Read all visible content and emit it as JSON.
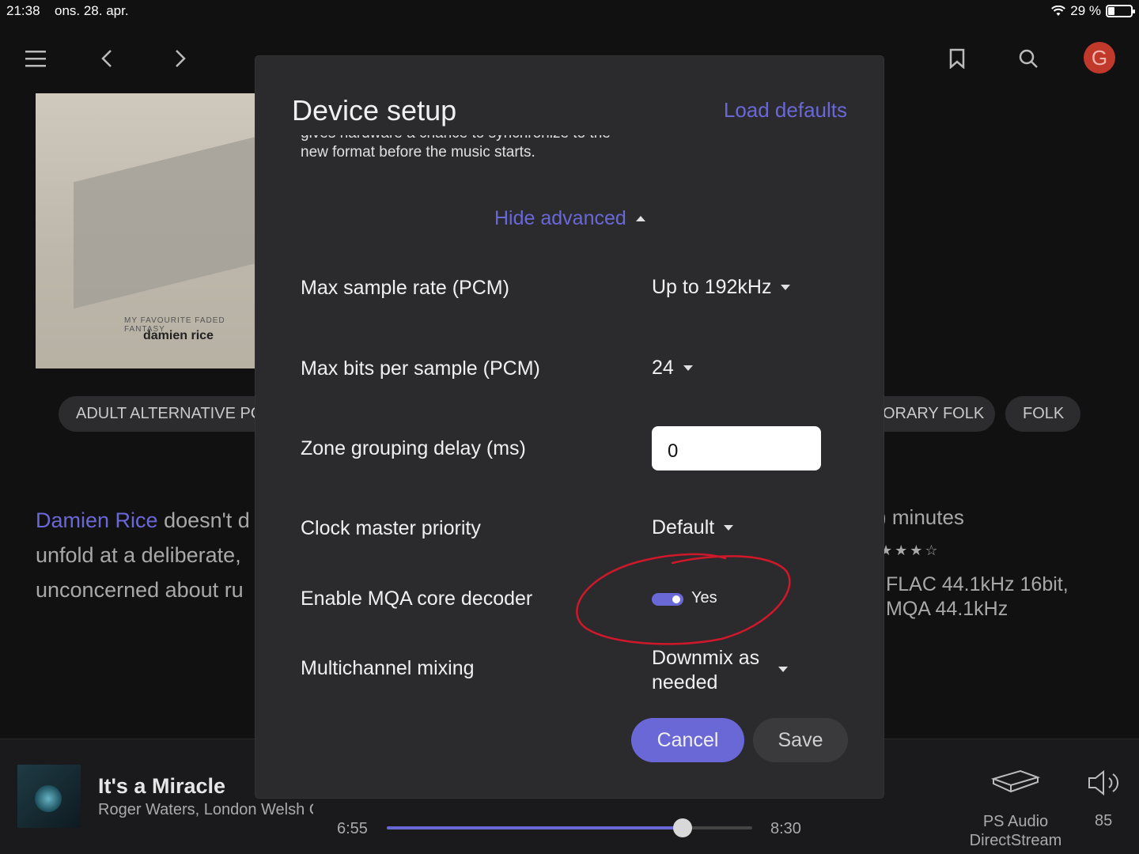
{
  "status_bar": {
    "time": "21:38",
    "date": "ons. 28. apr.",
    "battery": "29 %"
  },
  "top_nav": {
    "avatar_letter": "G"
  },
  "background": {
    "album": {
      "title": "MY FAVOURITE FADED FANTASY",
      "artist": "damien rice"
    },
    "genre_chips": [
      "ADULT ALTERNATIVE PC",
      "ORARY FOLK",
      "FOLK"
    ],
    "bio": {
      "artist_link": "Damien Rice",
      "line1_rest": " doesn't d",
      "line2": "unfold at a deliberate,",
      "line3": "unconcerned about ru"
    },
    "details": {
      "duration": ") minutes",
      "rating": "★★★☆",
      "format_line1": "FLAC 44.1kHz 16bit,",
      "format_line2": "MQA 44.1kHz"
    }
  },
  "dialog": {
    "title": "Device setup",
    "load_defaults": "Load defaults",
    "description_line1": "gives hardware a chance to synchronize to the",
    "description_line2": "new format before the music starts.",
    "hide_advanced": "Hide advanced",
    "settings": {
      "max_sample_rate": {
        "label": "Max sample rate (PCM)",
        "value": "Up to 192kHz"
      },
      "max_bits": {
        "label": "Max bits per sample (PCM)",
        "value": "24"
      },
      "zone_grouping_delay": {
        "label": "Zone grouping delay (ms)",
        "value": "0"
      },
      "clock_master": {
        "label": "Clock master priority",
        "value": "Default"
      },
      "mqa_decoder": {
        "label": "Enable MQA core decoder",
        "value": "Yes",
        "enabled": true
      },
      "multichannel": {
        "label": "Multichannel mixing",
        "value_line1": "Downmix as",
        "value_line2": "needed"
      }
    },
    "cancel": "Cancel",
    "save": "Save"
  },
  "player": {
    "track": "It's a Miracle",
    "artist": "Roger Waters, London Welsh C",
    "elapsed": "6:55",
    "total": "8:30",
    "progress": 0.81,
    "zone_line1": "PS Audio",
    "zone_line2": "DirectStream",
    "volume": "85"
  },
  "colors": {
    "accent": "#6a68d6",
    "dialog_bg": "#2b2b2d",
    "annotation": "#d0182b"
  }
}
